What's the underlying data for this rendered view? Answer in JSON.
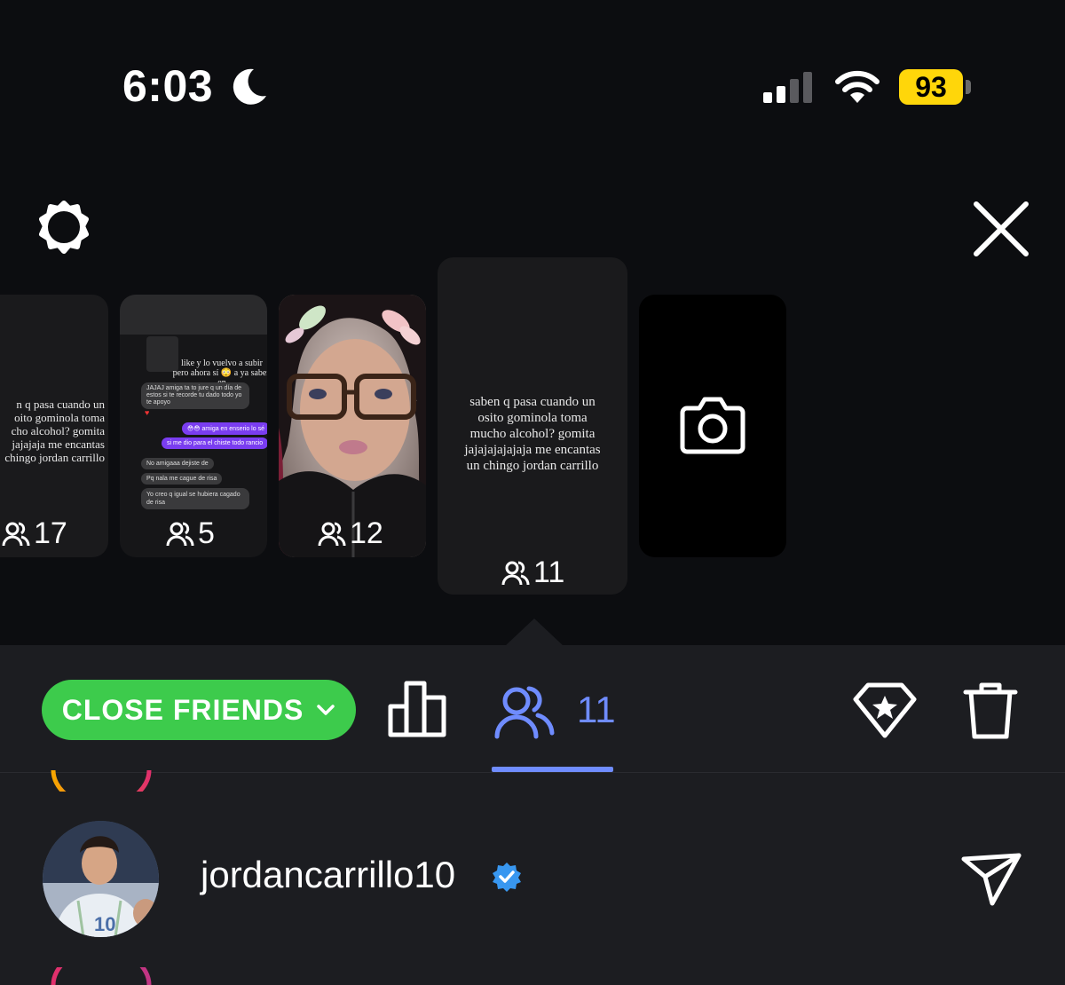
{
  "status_bar": {
    "time": "6:03",
    "battery": "93"
  },
  "stories": [
    {
      "lines": [
        "n q pasa cuando un",
        "oito gominola toma",
        "cho alcohol? gomita",
        "jajajaja me encantas",
        "chingo jordan carrillo"
      ],
      "viewers": "17"
    },
    {
      "viewers": "5",
      "chat": {
        "header": [
          "like y lo vuelvo a subir",
          "pero ahora sí 😳 a ya saben",
          "en"
        ],
        "msgs": [
          "JAJAJ amiga ta to jure q un día de",
          "estos si te recorde tu dado todo yo",
          "te apoyo",
          "😳😳 amiga en enserio lo sé",
          "si me dio para el chiste todo rancio",
          "No amigaaa dejiste de",
          "Pq nala me cague de risa",
          "Yo creo q igual se hubiera cagado",
          "de risa"
        ]
      }
    },
    {
      "viewers": "12"
    },
    {
      "lines": [
        "saben q pasa cuando un",
        "osito gominola toma",
        "mucho alcohol? gomita",
        "jajajajajajaja me encantas",
        "un chingo jordan carrillo"
      ],
      "viewers": "11"
    }
  ],
  "toolbar": {
    "audience_label": "CLOSE FRIENDS",
    "viewers_count": "11"
  },
  "viewer_list": [
    {
      "username": "jordancarrillo10",
      "verified": true,
      "jersey_number": "10"
    }
  ],
  "colors": {
    "accent_blue": "#6f8cff",
    "close_friends_green": "#3dcb4c",
    "battery_yellow": "#ffd60a"
  }
}
